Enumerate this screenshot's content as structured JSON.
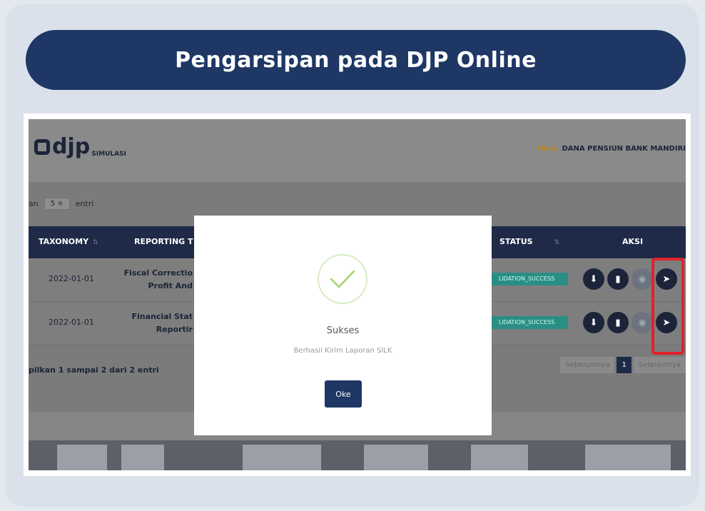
{
  "banner": {
    "title": "Pengarsipan pada DJP Online"
  },
  "app": {
    "logo_text": "djp",
    "logo_sub": "SIMULASI",
    "greeting_label": "Halo,",
    "user_name": "DANA PENSIUN BANK MANDIRI"
  },
  "table": {
    "entries_prefix": "an",
    "entries_value": "5 ≑",
    "entries_suffix": "entri",
    "headers": {
      "taxonomy": "TAXONOMY",
      "reporting": "REPORTING T",
      "status": "STATUS",
      "actions": "AKSI"
    },
    "rows": [
      {
        "taxonomy": "2022-01-01",
        "report_line1": "Fiscal Correctio",
        "report_line2": "Profit And",
        "status": "LIDATION_SUCCESS"
      },
      {
        "taxonomy": "2022-01-01",
        "report_line1": "Financial Stat",
        "report_line2": "Reportir",
        "status": "LIDATION_SUCCESS"
      }
    ],
    "footer_info": "pilkan 1 sampai 2 dari 2 entri",
    "pager": {
      "prev": "Sebelumnya",
      "page": "1",
      "next": "Selanjutnya"
    }
  },
  "modal": {
    "title": "Sukses",
    "message": "Berhasil Kirim Laporan SILK",
    "ok_label": "Oke"
  },
  "colors": {
    "brand_navy": "#1e3765",
    "success_green": "#2b8e85",
    "highlight_red": "#e3202a"
  }
}
